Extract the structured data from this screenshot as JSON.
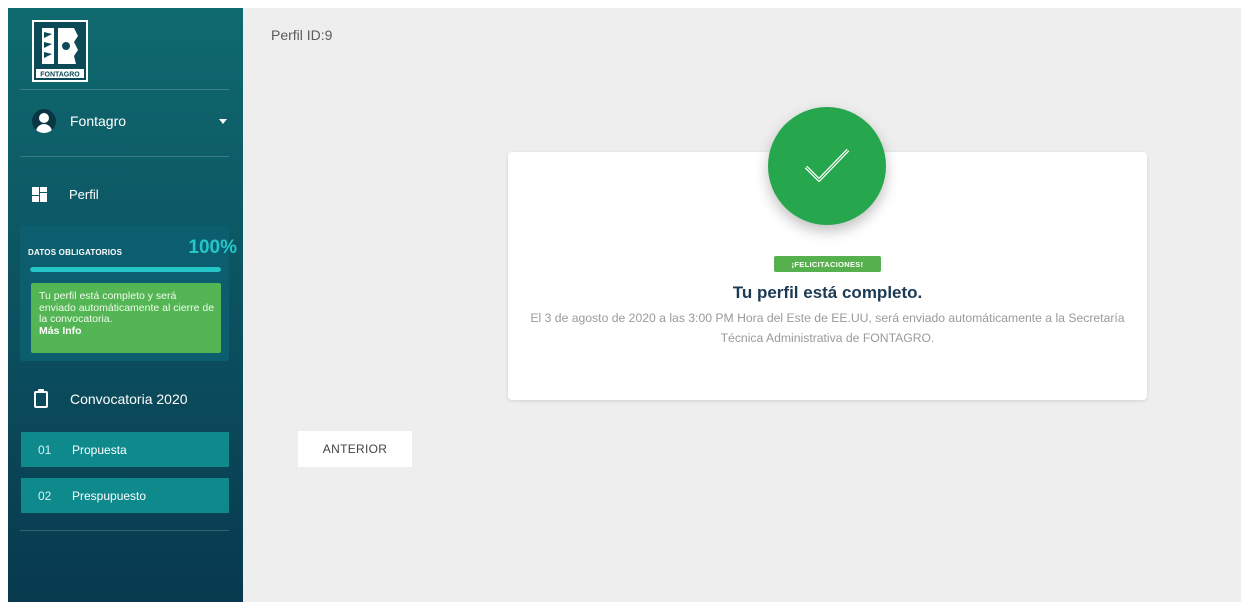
{
  "sidebar": {
    "logo_text": "FONTAGRO",
    "user": {
      "name": "Fontagro"
    },
    "perfil_label": "Perfil",
    "datos": {
      "title": "DATOS OBLIGATORIOS",
      "percent_label": "100%",
      "progress": 1.0,
      "message": "Tu perfil está completo y será enviado automáticamente al cierre de la convocatoria.",
      "link": "Más Info"
    },
    "convocatoria_label": "Convocatoria 2020",
    "steps": [
      {
        "num": "01",
        "label": "Propuesta"
      },
      {
        "num": "02",
        "label": "Prespupuesto"
      }
    ]
  },
  "main": {
    "perfil_id": "Perfil ID:9",
    "badge": "¡FELICITACIONES!",
    "title": "Tu perfil está completo.",
    "description": "El 3 de agosto de 2020 a las 3:00 PM Hora del Este de EE.UU, será enviado automáticamente a la Secretaría Técnica Administrativa de FONTAGRO.",
    "anterior_button": "ANTERIOR"
  },
  "colors": {
    "sidebar_top": "#0f6a6f",
    "sidebar_bottom": "#08394e",
    "accent_cyan": "#25c6c8",
    "success_green": "#26a74d",
    "info_green": "#53b553",
    "step_teal": "#0e8a8d"
  },
  "icons": [
    "fontagro-logo",
    "user-avatar-icon",
    "caret-down-icon",
    "dashboard-grid-icon",
    "clipboard-icon",
    "checkmark-icon"
  ]
}
